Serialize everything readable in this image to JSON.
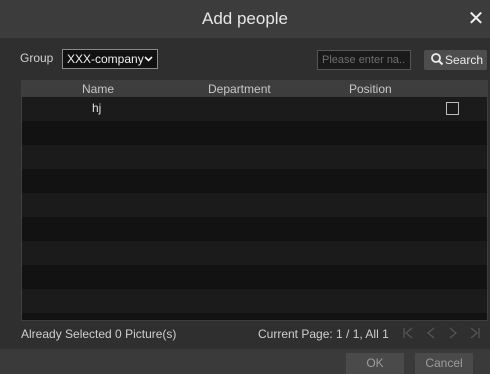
{
  "dialog": {
    "title": "Add people"
  },
  "filter": {
    "group_label": "Group",
    "group_value": "XXX-company",
    "search_placeholder": "Please enter na...",
    "search_button": "Search"
  },
  "table": {
    "columns": [
      "Name",
      "Department",
      "Position"
    ],
    "rows": [
      {
        "name": "hj",
        "department": "",
        "position": "",
        "checked": false
      }
    ]
  },
  "footer": {
    "selected_text": "Already Selected 0 Picture(s)",
    "page_text": "Current Page: 1 / 1, All 1"
  },
  "actions": {
    "ok": "OK",
    "cancel": "Cancel"
  },
  "colors": {
    "background": "#2f2f2f",
    "header": "#3d3d3d",
    "row_odd": "#1b1b1b",
    "row_even": "#121212"
  }
}
